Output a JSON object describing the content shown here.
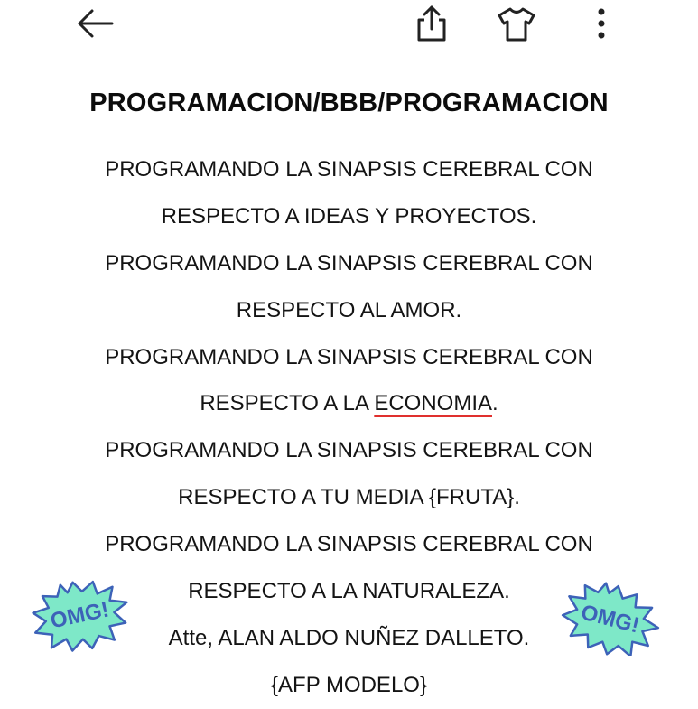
{
  "toolbar": {
    "back_icon": "arrow-left-icon",
    "share_icon": "share-icon",
    "shirt_icon": "tshirt-icon",
    "more_icon": "more-vertical-icon"
  },
  "title": "PROGRAMACION/BBB/PROGRAMACION",
  "lines": [
    "PROGRAMANDO LA SINAPSIS CEREBRAL CON",
    "RESPECTO A IDEAS Y PROYECTOS.",
    "PROGRAMANDO LA SINAPSIS CEREBRAL CON",
    "RESPECTO AL AMOR.",
    "PROGRAMANDO LA SINAPSIS CEREBRAL CON",
    {
      "before": "RESPECTO A LA ",
      "flagged": "ECONOMIA",
      "after": "."
    },
    "PROGRAMANDO LA SINAPSIS CEREBRAL CON",
    "RESPECTO A TU MEDIA {FRUTA}.",
    "PROGRAMANDO LA SINAPSIS CEREBRAL CON",
    "RESPECTO A LA NATURALEZA.",
    "Atte, ALAN ALDO NUÑEZ DALLETO.",
    "{AFP MODELO}"
  ],
  "stickers": {
    "left": {
      "text": "OMG!",
      "icon": "omg-burst-sticker"
    },
    "right": {
      "text": "OMG!",
      "icon": "omg-burst-sticker"
    }
  },
  "colors": {
    "spellcheck_underline": "#e0302e",
    "sticker_fill": "#7ee8c8",
    "sticker_text": "#3d62b8"
  }
}
